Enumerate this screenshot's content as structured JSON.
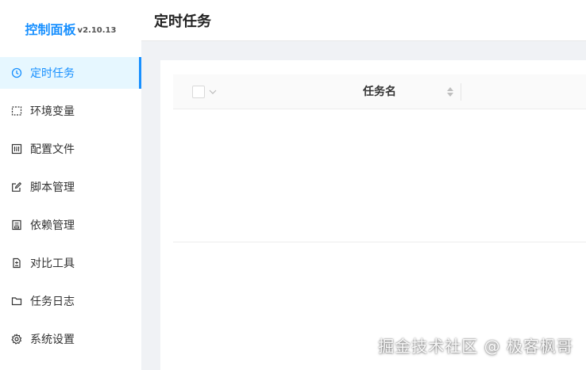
{
  "app": {
    "title": "控制面板",
    "version": "v2.10.13"
  },
  "sidebar": {
    "items": [
      {
        "label": "定时任务",
        "icon": "clock-icon",
        "active": true
      },
      {
        "label": "环境变量",
        "icon": "dashed-box-icon",
        "active": false
      },
      {
        "label": "配置文件",
        "icon": "config-file-icon",
        "active": false
      },
      {
        "label": "脚本管理",
        "icon": "edit-icon",
        "active": false
      },
      {
        "label": "依赖管理",
        "icon": "package-icon",
        "active": false
      },
      {
        "label": "对比工具",
        "icon": "diff-icon",
        "active": false
      },
      {
        "label": "任务日志",
        "icon": "folder-icon",
        "active": false
      },
      {
        "label": "系统设置",
        "icon": "gear-icon",
        "active": false
      }
    ]
  },
  "header": {
    "title": "定时任务"
  },
  "table": {
    "columns": [
      {
        "label": "任务名",
        "sortable": true
      }
    ],
    "rows": []
  },
  "watermark": "掘金技术社区 @ 极客枫哥",
  "colors": {
    "accent": "#1890ff",
    "active_bg": "#e6f7ff"
  }
}
